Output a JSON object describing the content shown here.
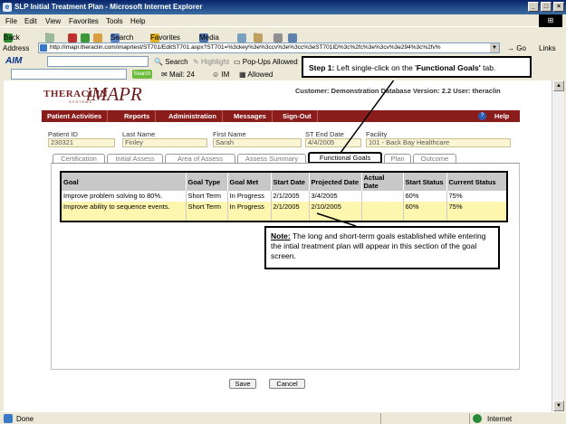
{
  "window": {
    "title": "SLP Initial Treatment Plan - Microsoft Internet Explorer"
  },
  "menu": [
    "File",
    "Edit",
    "View",
    "Favorites",
    "Tools",
    "Help"
  ],
  "toolbar": {
    "back": "Back",
    "search": "Search",
    "favorites": "Favorites",
    "media": "Media"
  },
  "address": {
    "label": "Address",
    "url": "http://imapr.theraclin.com/imaprtest/ST701/EditST701.aspx?ST701=%3ckey%3e%3ccv%3e%3cc%3eST701ID%3c%2fc%3e%3cv%3e294%3c%2fv%",
    "go": "Go",
    "links": "Links"
  },
  "aimbar": {
    "logo": "AIM",
    "search": "Search",
    "highlight": "Highlight",
    "popups": "Pop-Ups Allowed"
  },
  "linkbar": {
    "search_btn": "Search",
    "mail": "Mail: 24",
    "im": "IM",
    "allowed": "Allowed"
  },
  "app": {
    "logo_thera": "THERACLIN",
    "logo_sub": "SYSTEMS",
    "logo_imapr": "iMAPR",
    "customer_line": "Customer: Demonstration Database Version: 2.2 User: theraclin",
    "nav": [
      "Patient Activities",
      "Reports",
      "Administration",
      "Messages",
      "Sign-Out"
    ],
    "help": "Help",
    "fields": {
      "patient_id": {
        "label": "Patient ID",
        "value": "230321"
      },
      "last_name": {
        "label": "Last Name",
        "value": "Finley"
      },
      "first_name": {
        "label": "First Name",
        "value": "Sarah"
      },
      "st_end_date": {
        "label": "ST End Date",
        "value": "4/4/2005"
      },
      "facility": {
        "label": "Facility",
        "value": "101 - Back Bay Healthcare"
      }
    },
    "tabs": [
      "Certification",
      "Initial Assess",
      "Area of Assess",
      "Assess Summary",
      "Functional Goals",
      "Plan",
      "Outcome"
    ],
    "goals_table": {
      "headers": [
        "Goal",
        "Goal Type",
        "Goal Met",
        "Start Date",
        "Projected Date",
        "Actual Date",
        "Start Status",
        "Current Status"
      ],
      "rows": [
        [
          "Improve problem solving to 80%.",
          "Short Term",
          "In Progress",
          "2/1/2005",
          "3/4/2005",
          "",
          "60%",
          "75%"
        ],
        [
          "Improve ability to sequence events.",
          "Short Term",
          "In Progress",
          "2/1/2005",
          "2/10/2005",
          "",
          "60%",
          "75%"
        ]
      ]
    },
    "buttons": {
      "save": "Save",
      "cancel": "Cancel"
    }
  },
  "callouts": {
    "step1_prefix": "Step 1:",
    "step1_text": " Left single-click on the '",
    "step1_bold": "Functional Goals'",
    "step1_suffix": " tab.",
    "note_label": "Note:",
    "note_text": " The long and short-term goals established while entering the intial treatment plan will appear in this section of the goal screen."
  },
  "status": {
    "left": "Done",
    "zone": "Internet"
  }
}
